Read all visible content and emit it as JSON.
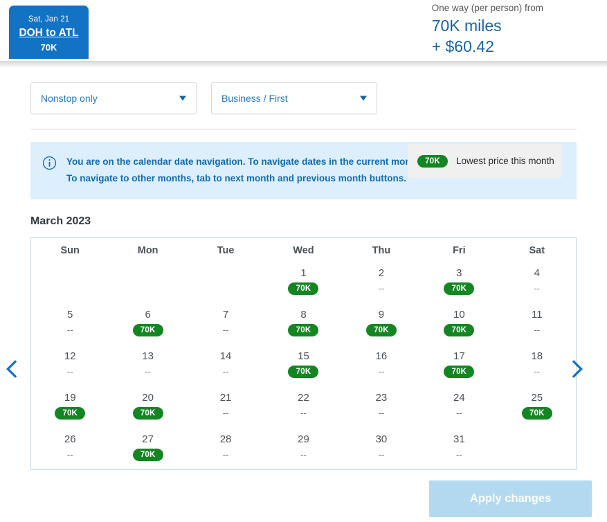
{
  "header": {
    "flight_tab": {
      "date": "Sat, Jan 21",
      "route": "DOH to ATL",
      "miles": "70K"
    },
    "price": {
      "label": "One way (per person) from",
      "miles": "70K miles",
      "cash": "+ $60.42"
    }
  },
  "filters": {
    "stops": {
      "value": "Nonstop only"
    },
    "cabin": {
      "value": "Business / First"
    },
    "legend": {
      "pill": "70K",
      "text": "Lowest price this month"
    }
  },
  "info_banner": {
    "icon": "info-circle-icon",
    "text": "You are on the calendar date navigation. To navigate dates in the current month, use the arrow keys. To navigate to other months, tab to next month and previous month buttons."
  },
  "calendar": {
    "month_title": "March 2023",
    "weekdays": [
      "Sun",
      "Mon",
      "Tue",
      "Wed",
      "Thu",
      "Fri",
      "Sat"
    ],
    "leading_blanks": 3,
    "no_price_text": "--",
    "pill_color": "#148523",
    "days": [
      {
        "day": "1",
        "price": "70K"
      },
      {
        "day": "2",
        "price": null
      },
      {
        "day": "3",
        "price": "70K"
      },
      {
        "day": "4",
        "price": null
      },
      {
        "day": "5",
        "price": null
      },
      {
        "day": "6",
        "price": "70K"
      },
      {
        "day": "7",
        "price": null
      },
      {
        "day": "8",
        "price": "70K"
      },
      {
        "day": "9",
        "price": "70K"
      },
      {
        "day": "10",
        "price": "70K"
      },
      {
        "day": "11",
        "price": null
      },
      {
        "day": "12",
        "price": null
      },
      {
        "day": "13",
        "price": null
      },
      {
        "day": "14",
        "price": null
      },
      {
        "day": "15",
        "price": "70K"
      },
      {
        "day": "16",
        "price": null
      },
      {
        "day": "17",
        "price": "70K"
      },
      {
        "day": "18",
        "price": null
      },
      {
        "day": "19",
        "price": "70K"
      },
      {
        "day": "20",
        "price": "70K"
      },
      {
        "day": "21",
        "price": null
      },
      {
        "day": "22",
        "price": null
      },
      {
        "day": "23",
        "price": null
      },
      {
        "day": "24",
        "price": null
      },
      {
        "day": "25",
        "price": "70K"
      },
      {
        "day": "26",
        "price": null
      },
      {
        "day": "27",
        "price": "70K"
      },
      {
        "day": "28",
        "price": null
      },
      {
        "day": "29",
        "price": null
      },
      {
        "day": "30",
        "price": null
      },
      {
        "day": "31",
        "price": null
      }
    ]
  },
  "navigation": {
    "prev_icon": "chevron-left-icon",
    "next_icon": "chevron-right-icon"
  },
  "footer": {
    "apply_label": "Apply changes",
    "apply_disabled": true
  }
}
